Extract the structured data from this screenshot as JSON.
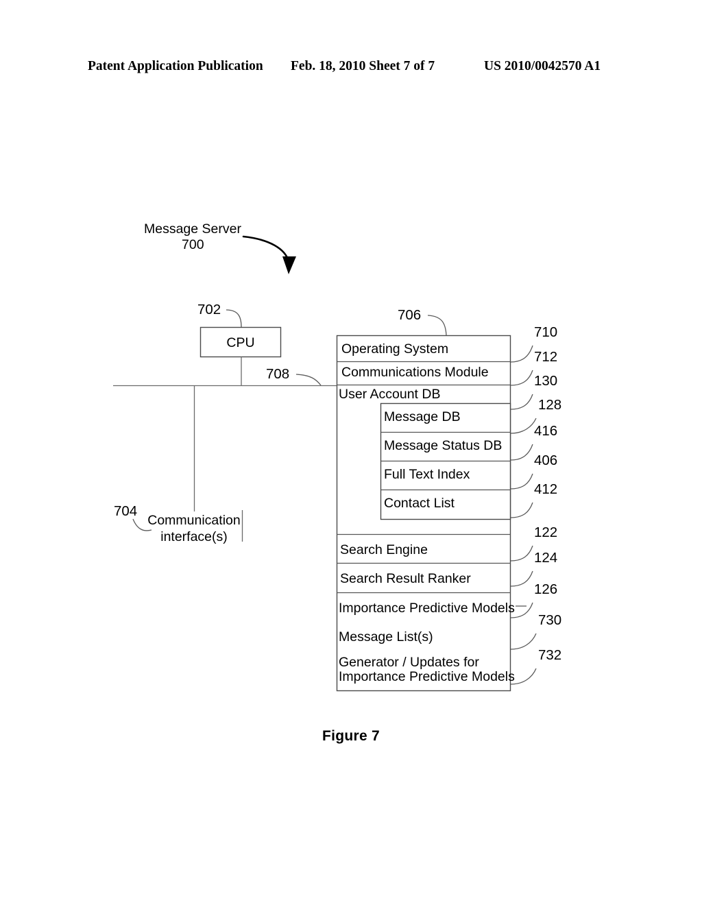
{
  "header": {
    "left": "Patent Application Publication",
    "middle": "Feb. 18, 2010  Sheet 7 of 7",
    "right": "US 2010/0042570 A1"
  },
  "figure": {
    "caption": "Figure 7",
    "title_label": "Message Server",
    "title_ref": "700"
  },
  "cpu": {
    "label": "CPU",
    "ref": "702"
  },
  "bus": {
    "ref": "708"
  },
  "comm_interface": {
    "label_line1": "Communication",
    "label_line2": "interface(s)",
    "ref": "704"
  },
  "memory": {
    "ref": "706",
    "rows": [
      {
        "label": "Operating System",
        "ref": "710"
      },
      {
        "label": "Communications Module",
        "ref": "712"
      },
      {
        "label": "User Account DB",
        "ref": "130"
      },
      {
        "label": "Message DB",
        "ref": "128"
      },
      {
        "label": "Message Status DB",
        "ref": "416"
      },
      {
        "label": "Full Text Index",
        "ref": "406"
      },
      {
        "label": "Contact List",
        "ref": "412"
      },
      {
        "label": "Search Engine",
        "ref": "122"
      },
      {
        "label": "Search Result Ranker",
        "ref": "124"
      },
      {
        "label": "Importance Predictive Models",
        "ref": "126"
      },
      {
        "label": "Message List(s)",
        "ref": "730"
      },
      {
        "label": "Generator / Updates for",
        "label2": "Importance Predictive Models",
        "ref": "732"
      }
    ]
  }
}
